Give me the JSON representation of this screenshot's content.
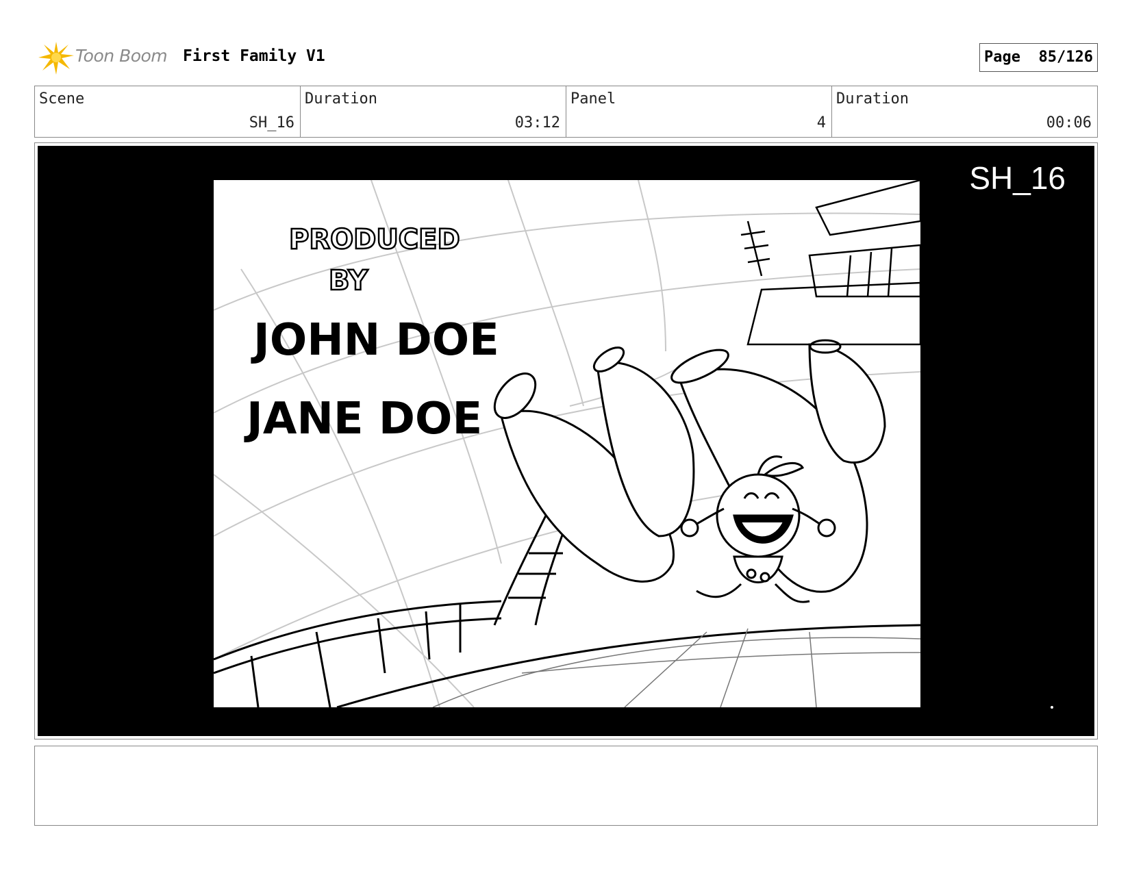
{
  "header": {
    "logo_text": "Toon Boom",
    "project_title": "First Family V1",
    "page_label": "Page",
    "page_number": "85/126"
  },
  "info": {
    "scene_label": "Scene",
    "scene_value": "SH_16",
    "scene_duration_label": "Duration",
    "scene_duration_value": "03:12",
    "panel_label": "Panel",
    "panel_value": "4",
    "panel_duration_label": "Duration",
    "panel_duration_value": "00:06"
  },
  "panel": {
    "shot_label": "SH_16",
    "credits": {
      "produced_by": "PRODUCED BY",
      "name_1": "JOHN DOE",
      "name_2": "JANE DOE"
    }
  },
  "notes": {
    "text": ""
  }
}
